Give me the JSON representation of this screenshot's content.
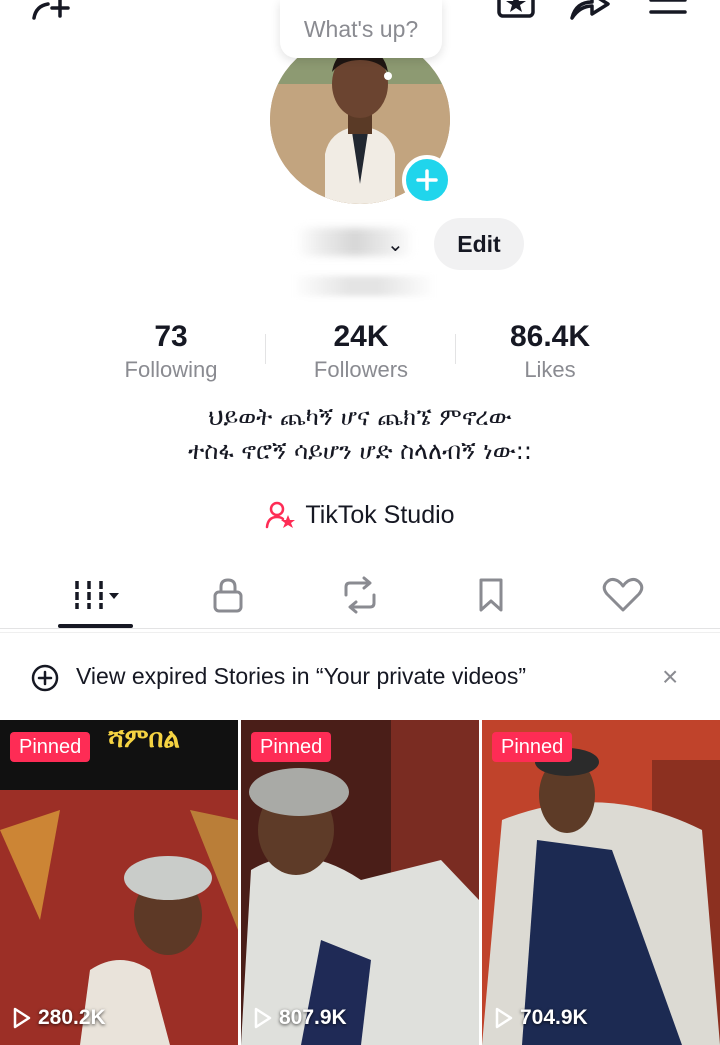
{
  "topbar": {
    "add_user_icon": "add-user-icon",
    "favorites_icon": "favorites-icon",
    "share_icon": "share-icon",
    "menu_icon": "menu-icon"
  },
  "status_bubble": {
    "text": "What's up?"
  },
  "profile": {
    "edit_label": "Edit"
  },
  "stats": [
    {
      "value": "73",
      "label": "Following"
    },
    {
      "value": "24K",
      "label": "Followers"
    },
    {
      "value": "86.4K",
      "label": "Likes"
    }
  ],
  "bio": {
    "line1": "ህይወት ጨካኝ ሆና ጨክኜ ምኖረው",
    "line2": "ተስፋ ኖሮኝ ሳይሆን ሆድ ስላለብኝ ነው::"
  },
  "studio": {
    "label": "TikTok Studio",
    "icon": "tiktok-studio-icon",
    "accent": "#fe2c55"
  },
  "tabs": [
    {
      "name": "videos",
      "icon": "grid-icon",
      "active": true
    },
    {
      "name": "private",
      "icon": "lock-icon"
    },
    {
      "name": "reposts",
      "icon": "repost-icon"
    },
    {
      "name": "favorites",
      "icon": "bookmark-icon"
    },
    {
      "name": "liked",
      "icon": "heart-icon"
    }
  ],
  "notice": {
    "text": "View expired Stories in “Your private videos”",
    "close": "×"
  },
  "videos": [
    {
      "badge": "Pinned",
      "views": "280.2K",
      "caption": "ሻምበል"
    },
    {
      "badge": "Pinned",
      "views": "807.9K"
    },
    {
      "badge": "Pinned",
      "views": "704.9K"
    }
  ],
  "colors": {
    "accent": "#fe2c55",
    "badge_blue": "#20d5ec",
    "text": "#161823",
    "muted": "#8a8b91"
  }
}
